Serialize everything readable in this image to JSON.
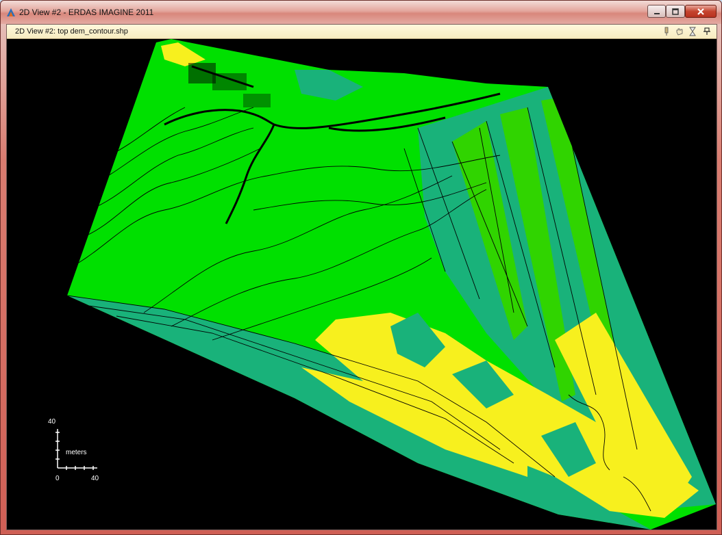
{
  "window": {
    "title": "2D View #2 - ERDAS IMAGINE 2011",
    "controls": {
      "minimize_icon": "minimize-icon",
      "maximize_icon": "maximize-icon",
      "close_icon": "close-icon"
    }
  },
  "view": {
    "title": "2D View #2: top dem_contour.shp",
    "toolbar_icons": [
      "pin-icon",
      "hand-icon",
      "hourglass-icon",
      "dock-pin-icon"
    ]
  },
  "map": {
    "colors": {
      "background": "#000000",
      "bright_green": "#00e000",
      "yellow_green": "#30d400",
      "teal": "#19b27a",
      "yellow": "#f7f01e",
      "speckle": "#3aa0a8",
      "contour": "#000000"
    },
    "scale_bar": {
      "top_label": "40",
      "unit_label": "meters",
      "origin_label": "0",
      "right_label": "40"
    }
  }
}
